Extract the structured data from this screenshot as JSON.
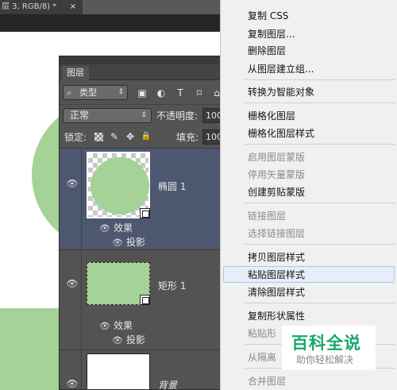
{
  "document": {
    "tab_title": "层 3, RGB/8) *",
    "close_label": "×"
  },
  "layers_panel": {
    "tab_label": "图层",
    "filter": {
      "search_glyph": "⌕",
      "kind_label": "类型",
      "arrows": "⇕",
      "icon_glyphs": [
        "▣",
        "◐",
        "T",
        "⌑",
        "⌂"
      ]
    },
    "blend": {
      "mode": "正常",
      "arrows": "⇕",
      "opacity_label": "不透明度:",
      "opacity_value": "100"
    },
    "lock": {
      "label": "锁定:",
      "brush_glyph": "✎",
      "move_glyph": "✥",
      "lock_glyph": "🔒",
      "fill_label": "填充:",
      "fill_value": "100"
    },
    "layers": [
      {
        "name": "椭圆 1",
        "effects_label": "效果",
        "effect_item": "投影"
      },
      {
        "name": "矩形 1",
        "effects_label": "效果",
        "effect_item": "投影"
      },
      {
        "name": "背景"
      }
    ],
    "eye_glyph": "👁"
  },
  "context_menu": {
    "items": [
      {
        "label": "复制 CSS",
        "enabled": true
      },
      {
        "label": "复制图层...",
        "enabled": true
      },
      {
        "label": "删除图层",
        "enabled": true
      },
      {
        "label": "从图层建立组...",
        "enabled": true
      },
      {
        "label": "转换为智能对象",
        "enabled": true
      },
      {
        "label": "栅格化图层",
        "enabled": true
      },
      {
        "label": "栅格化图层样式",
        "enabled": true
      },
      {
        "label": "启用图层蒙版",
        "enabled": false
      },
      {
        "label": "停用矢量蒙版",
        "enabled": false
      },
      {
        "label": "创建剪贴蒙版",
        "enabled": true
      },
      {
        "label": "链接图层",
        "enabled": false
      },
      {
        "label": "选择链接图层",
        "enabled": false
      },
      {
        "label": "拷贝图层样式",
        "enabled": true
      },
      {
        "label": "粘贴图层样式",
        "enabled": true,
        "highlighted": true
      },
      {
        "label": "清除图层样式",
        "enabled": true
      },
      {
        "label": "复制形状属性",
        "enabled": true
      },
      {
        "label": "粘贴形",
        "enabled": false
      },
      {
        "label": "从隔离",
        "enabled": false
      },
      {
        "label": "合并图层",
        "enabled": false
      }
    ]
  },
  "watermark": {
    "title": "百科全说",
    "subtitle": "助你轻松解决"
  },
  "colors": {
    "shape_green": "#a5d296",
    "panel_bg": "#535353",
    "selected_row": "#4d5870",
    "menu_bg": "#f0f0f0",
    "watermark_green": "#17a86e"
  }
}
